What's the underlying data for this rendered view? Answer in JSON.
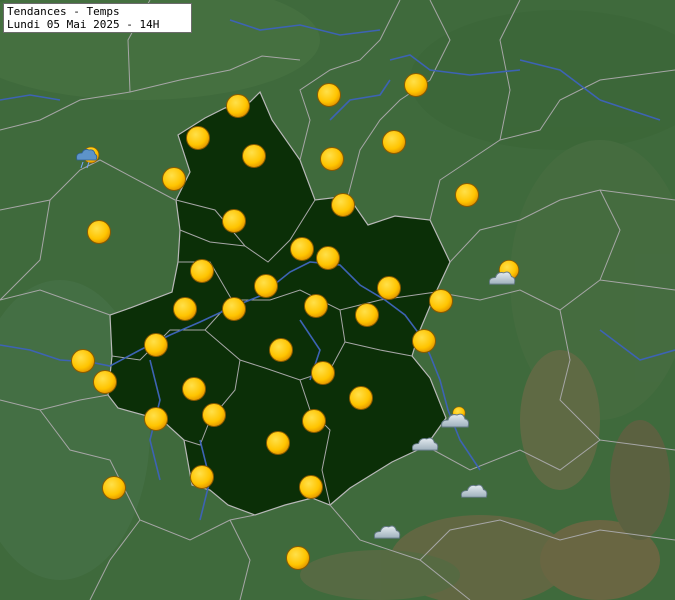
{
  "title": {
    "line1": "Tendances - Temps",
    "line2": "Lundi 05 Mai 2025 - 14H"
  },
  "colors": {
    "terrain": "#3f6a3c",
    "region": "#0b2f07",
    "sun": "#ffc400",
    "river": "#3d63b4",
    "border": "#9a9a9a"
  },
  "legend_icons": {
    "sun": "sun-icon",
    "partly_cloudy": "sun-cloud-icon",
    "cloud": "cloud-icon",
    "showers": "rain-cloud-icon"
  }
}
